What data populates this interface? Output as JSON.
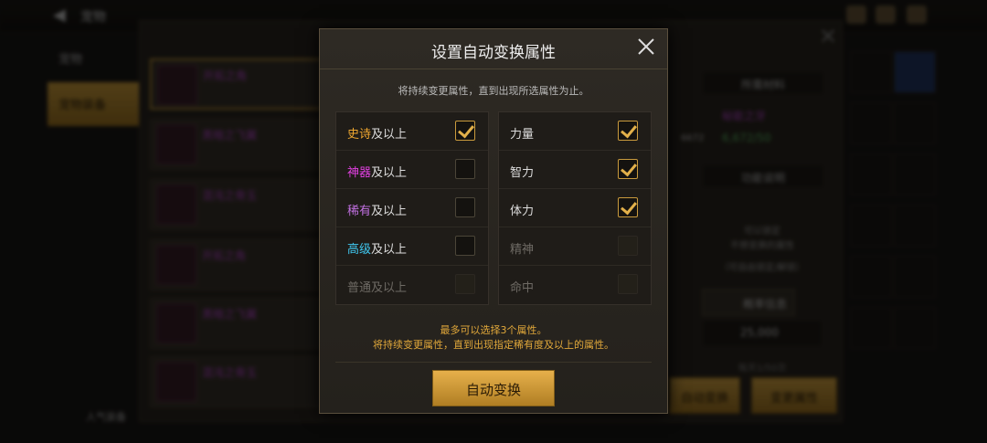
{
  "topbar": {
    "title": "宠物",
    "back_label": "←"
  },
  "left_tabs": [
    {
      "label": "宠物"
    },
    {
      "label": "宠物装备"
    }
  ],
  "bg_list": [
    {
      "name": "开拓之角"
    },
    {
      "name": "黑暗之飞翼"
    },
    {
      "name": "混沌之骨玉"
    },
    {
      "name": "开拓之角"
    },
    {
      "name": "黑暗之飞翼"
    },
    {
      "name": "混沌之骨玉"
    }
  ],
  "right_panel": {
    "materials_title": "所需材料",
    "material_name": "秘能之牙",
    "material_count": "6,672/50",
    "material_badge": "6672",
    "function_title": "功能说明",
    "function_desc_1": "可以锁定",
    "function_desc_2": "不想变换的属性",
    "function_desc_3": "（可自由锁定/解锁）",
    "prob_label": "概率信息",
    "cost": "25,000",
    "daily": "每天1/50次",
    "auto_label": "自动变换",
    "change_label": "变更属性"
  },
  "bottom_left": {
    "label": "人气装备"
  },
  "modal": {
    "title": "设置自动变换属性",
    "description": "将持续变更属性，直到出现所选属性为止。",
    "rarity_options": [
      {
        "prefix": "史诗",
        "suffix": "及以上",
        "color": "#f0a830",
        "checked": true,
        "disabled": false
      },
      {
        "prefix": "神器",
        "suffix": "及以上",
        "color": "#e040e0",
        "checked": false,
        "disabled": false
      },
      {
        "prefix": "稀有",
        "suffix": "及以上",
        "color": "#c070e0",
        "checked": false,
        "disabled": false
      },
      {
        "prefix": "高级",
        "suffix": "及以上",
        "color": "#40c8f0",
        "checked": false,
        "disabled": false
      },
      {
        "prefix": "普通",
        "suffix": "及以上",
        "color": "#6e6a64",
        "checked": false,
        "disabled": true
      }
    ],
    "stat_options": [
      {
        "label": "力量",
        "checked": true,
        "disabled": false
      },
      {
        "label": "智力",
        "checked": true,
        "disabled": false
      },
      {
        "label": "体力",
        "checked": true,
        "disabled": false
      },
      {
        "label": "精神",
        "checked": false,
        "disabled": true
      },
      {
        "label": "命中",
        "checked": false,
        "disabled": true
      }
    ],
    "note_line1": "最多可以选择3个属性。",
    "note_line2": "将持续变更属性，直到出现指定稀有度及以上的属性。",
    "auto_button": "自动变换"
  }
}
